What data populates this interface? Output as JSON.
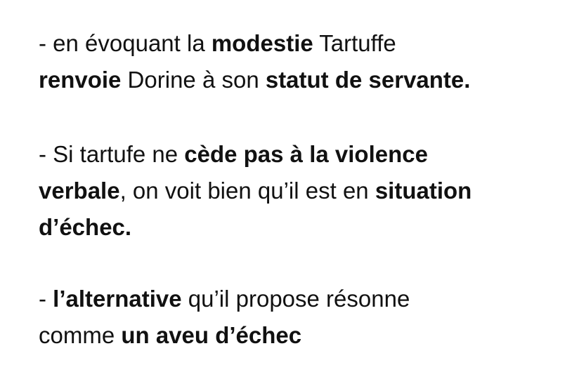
{
  "paragraphs": [
    {
      "lines": [
        [
          {
            "text": "- en évoquant la ",
            "bold": false
          },
          {
            "text": "modestie",
            "bold": true
          },
          {
            "text": " Tartuffe",
            "bold": false
          }
        ],
        [
          {
            "text": "renvoie",
            "bold": true
          },
          {
            "text": " Dorine à son ",
            "bold": false
          },
          {
            "text": "statut de servante.",
            "bold": true
          }
        ]
      ]
    },
    {
      "lines": [
        [
          {
            "text": "- Si tartufe ne ",
            "bold": false
          },
          {
            "text": "cède pas à la violence",
            "bold": true
          }
        ],
        [
          {
            "text": "verbale",
            "bold": true
          },
          {
            "text": ", on voit bien qu’il est en ",
            "bold": false
          },
          {
            "text": "situation",
            "bold": true
          }
        ],
        [
          {
            "text": "d’échec.",
            "bold": true
          }
        ]
      ]
    },
    {
      "lines": [
        [
          {
            "text": "- ",
            "bold": false
          },
          {
            "text": "l’alternative",
            "bold": true
          },
          {
            "text": " qu’il propose résonne",
            "bold": false
          }
        ],
        [
          {
            "text": "comme ",
            "bold": false
          },
          {
            "text": "un aveu d’échec",
            "bold": true
          }
        ]
      ]
    }
  ]
}
